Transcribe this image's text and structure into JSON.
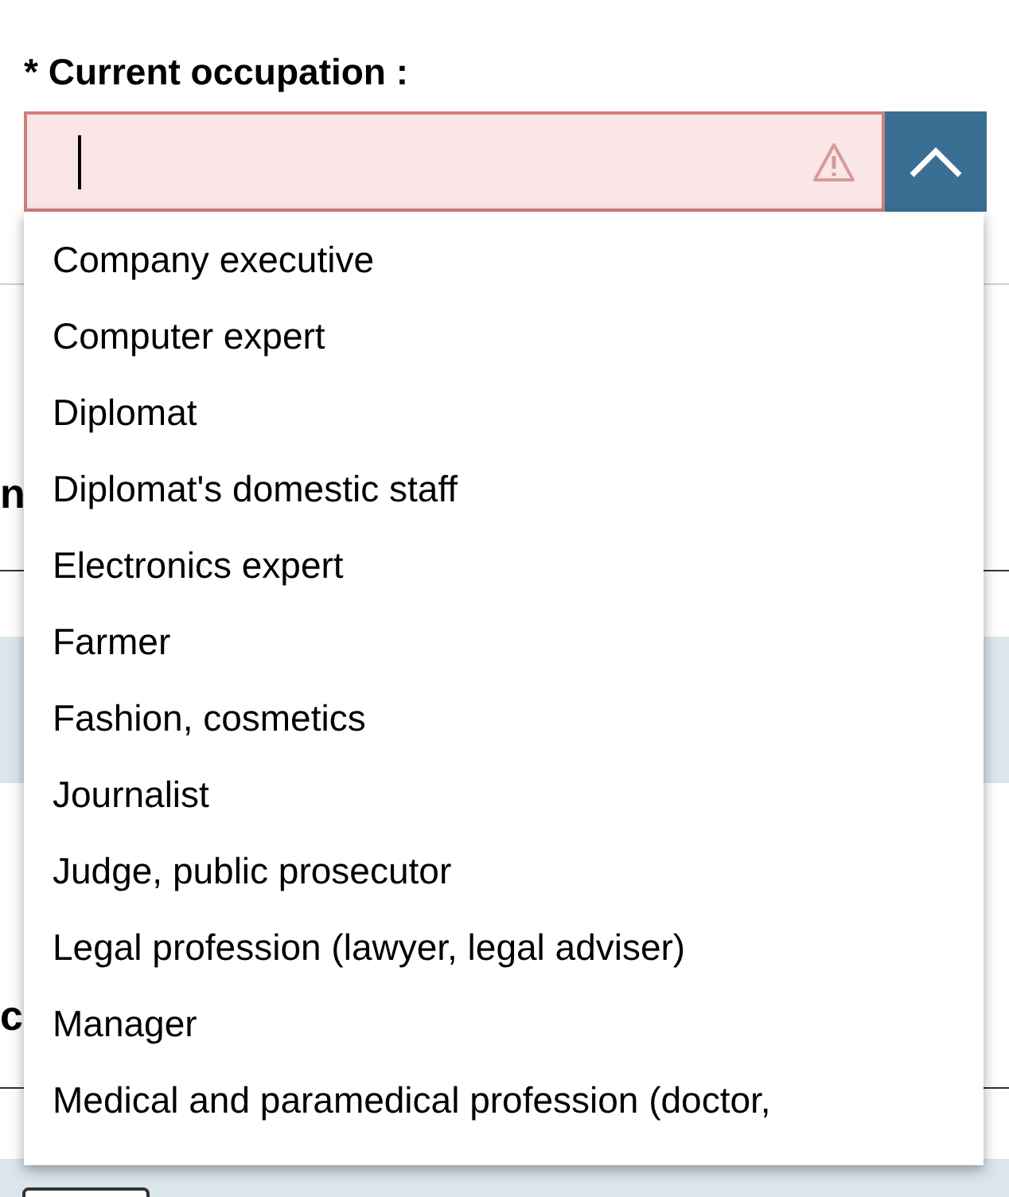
{
  "field": {
    "label": "* Current occupation :",
    "invalid": true,
    "expanded": true
  },
  "background_fragments": [
    "n",
    "c"
  ],
  "options": [
    "Company executive",
    "Computer expert",
    "Diplomat",
    "Diplomat's domestic staff",
    "Electronics expert",
    "Farmer",
    "Fashion, cosmetics",
    "Journalist",
    "Judge, public prosecutor",
    "Legal profession (lawyer, legal adviser)",
    "Manager",
    "Medical and paramedical profession (doctor,"
  ]
}
